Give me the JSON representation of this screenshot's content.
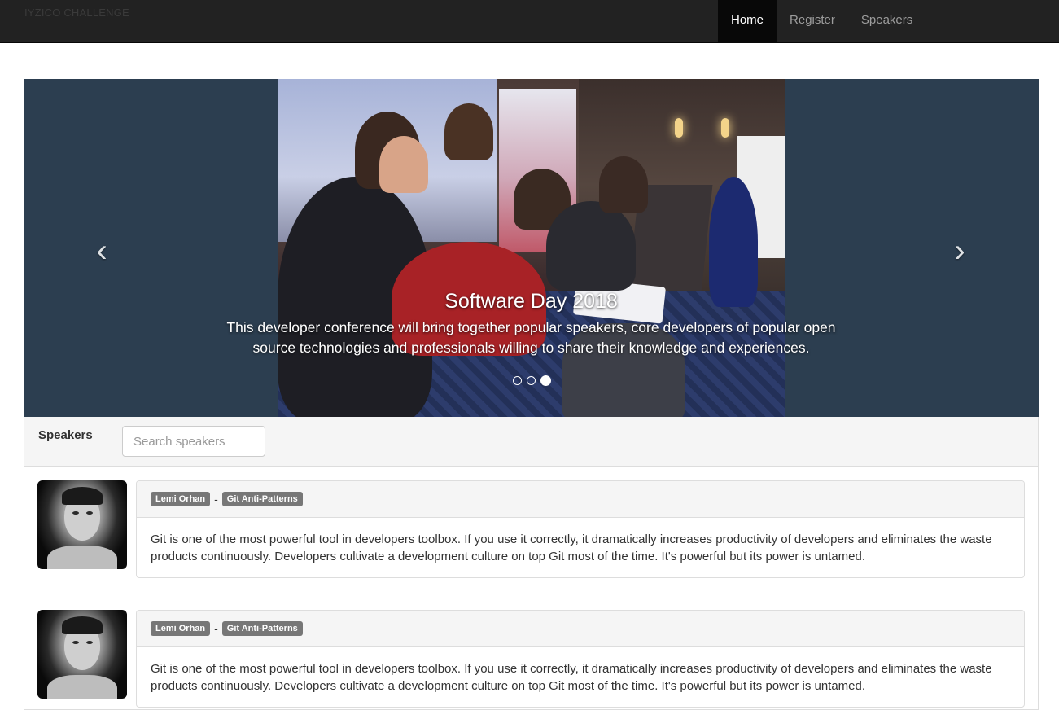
{
  "navbar": {
    "brand": "IYZICO CHALLENGE",
    "items": [
      {
        "label": "Home",
        "active": true
      },
      {
        "label": "Register",
        "active": false
      },
      {
        "label": "Speakers",
        "active": false
      }
    ]
  },
  "carousel": {
    "title": "Software Day 2018",
    "text": "This developer conference will bring together popular speakers, core developers of popular open source technologies and professionals willing to share their knowledge and experiences.",
    "prev_icon": "chevron-left-icon",
    "next_icon": "chevron-right-icon",
    "slide_count": 3,
    "active_slide": 3
  },
  "speakers_panel": {
    "title": "Speakers",
    "search": {
      "placeholder": "Search speakers",
      "value": ""
    },
    "items": [
      {
        "name": "Lemi Orhan",
        "separator": "-",
        "topic": "Git Anti-Patterns",
        "description": "Git is one of the most powerful tool in developers toolbox. If you use it correctly, it dramatically increases productivity of developers and eliminates the waste products continuously. Developers cultivate a development culture on top Git most of the time. It's powerful but its power is untamed."
      },
      {
        "name": "Lemi Orhan",
        "separator": "-",
        "topic": "Git Anti-Patterns",
        "description": "Git is one of the most powerful tool in developers toolbox. If you use it correctly, it dramatically increases productivity of developers and eliminates the waste products continuously. Developers cultivate a development culture on top Git most of the time. It's powerful but its power is untamed."
      }
    ]
  },
  "colors": {
    "navbar_bg": "#222222",
    "nav_active_bg": "#080808",
    "carousel_bg": "#2c3e50",
    "label_bg": "#777777",
    "panel_heading_bg": "#f5f5f5"
  }
}
